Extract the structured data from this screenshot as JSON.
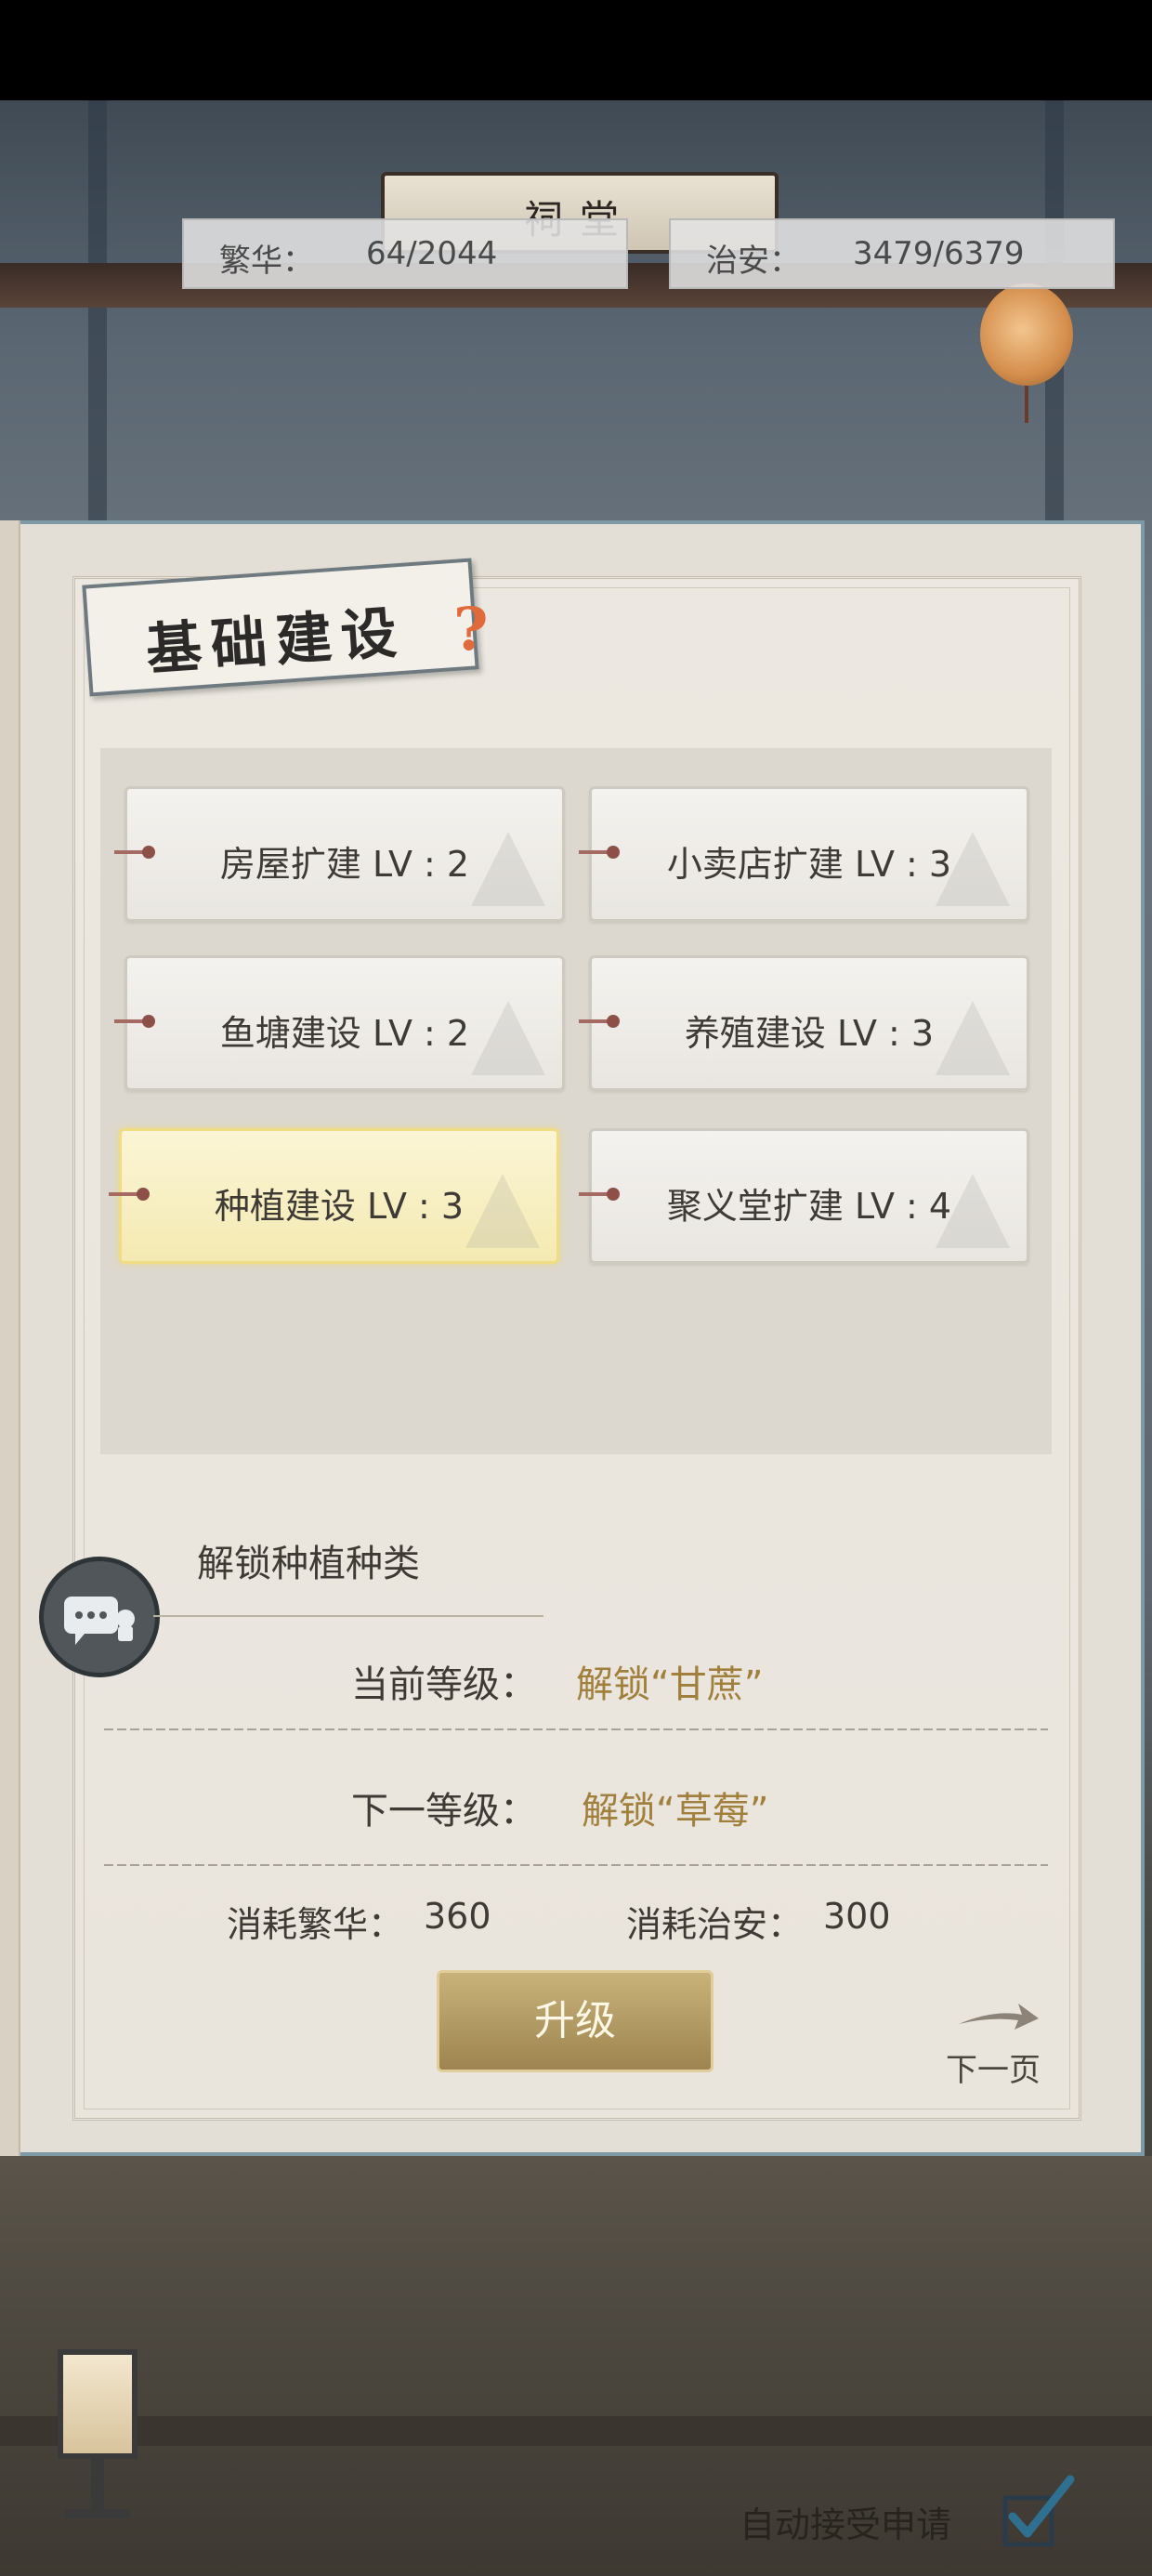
{
  "banner": {
    "title": "祠堂"
  },
  "stats": {
    "prosperity_label": "繁华：",
    "prosperity_value": "64/2044",
    "security_label": "治安：",
    "security_value": "3479/6379"
  },
  "panel": {
    "title": "基础建设",
    "help_icon": "question-mark-icon"
  },
  "buildings": [
    {
      "label": "房屋扩建 LV : 2",
      "selected": false
    },
    {
      "label": "小卖店扩建 LV : 3",
      "selected": false
    },
    {
      "label": "鱼塘建设 LV : 2",
      "selected": false
    },
    {
      "label": "养殖建设 LV : 3",
      "selected": false
    },
    {
      "label": "种植建设 LV : 3",
      "selected": true
    },
    {
      "label": "聚义堂扩建 LV : 4",
      "selected": false
    }
  ],
  "detail": {
    "description": "解锁种植种类",
    "current_label": "当前等级：",
    "current_value": "解锁“甘蔗”",
    "next_label": "下一等级：",
    "next_value": "解锁“草莓”",
    "cost_prosperity_label": "消耗繁华：",
    "cost_prosperity_value": "360",
    "cost_security_label": "消耗治安：",
    "cost_security_value": "300"
  },
  "actions": {
    "upgrade_label": "升级",
    "next_page_label": "下一页"
  },
  "footer": {
    "auto_accept_label": "自动接受申请",
    "auto_accept_checked": true
  },
  "colors": {
    "accent_gold": "#a0803c",
    "selected_card": "#f4eab2",
    "button_gold": "#c9b27a"
  }
}
